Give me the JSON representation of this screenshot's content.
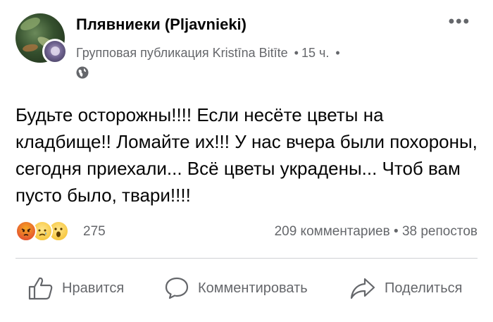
{
  "post": {
    "group_name": "Плявниеки (Pljavnieki)",
    "post_type": "Групповая публикация",
    "author": "Kristīna Bitīte",
    "time": "15 ч.",
    "separator": "•",
    "more_icon": "more-horizontal-icon",
    "privacy_icon": "globe-icon",
    "text": "Будьте осторожны!!!! Если несёте цветы на кладбище!! Ломайте их!!! У нас вчера были похороны, сегодня приехали... Всё цветы украдены... Чтоб вам пусто было, твари!!!!"
  },
  "reactions": {
    "types": [
      "angry",
      "sad",
      "wow"
    ],
    "count": "275"
  },
  "stats": {
    "comments": "209 комментариев",
    "shares": "38 репостов",
    "separator": "•"
  },
  "actions": {
    "like_label": "Нравится",
    "comment_label": "Комментировать",
    "share_label": "Поделиться"
  },
  "colors": {
    "text": "#050505",
    "secondary": "#65676b",
    "divider": "#ced0d4"
  }
}
